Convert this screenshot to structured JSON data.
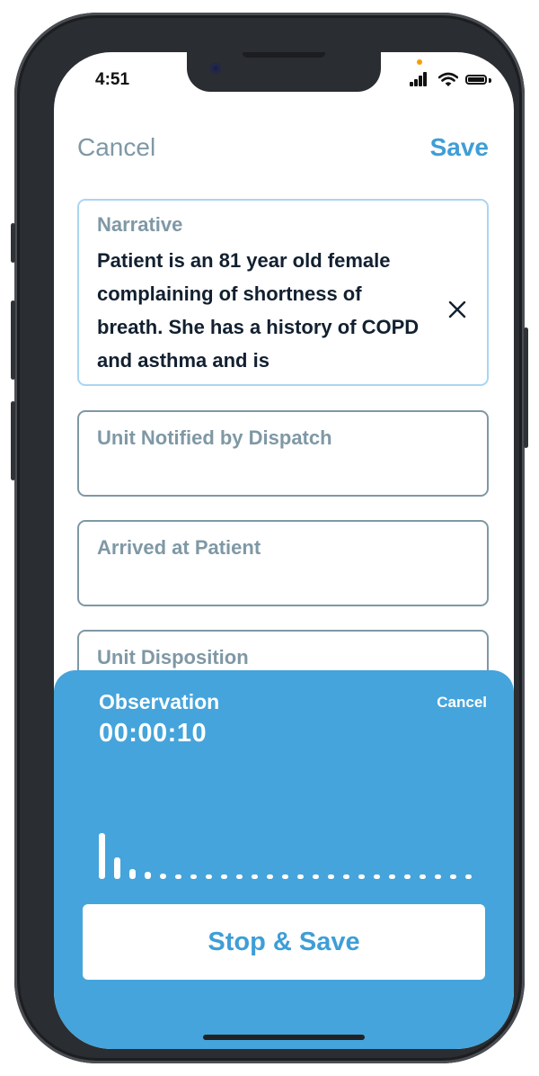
{
  "status_bar": {
    "time": "4:51"
  },
  "nav": {
    "cancel_label": "Cancel",
    "save_label": "Save"
  },
  "fields": {
    "narrative": {
      "label": "Narrative",
      "value": "Patient is an 81 year old female complaining of shortness of breath. She has a history of COPD and asthma and is"
    },
    "unit_notified": {
      "label": "Unit Notified by Dispatch"
    },
    "arrived_at_patient": {
      "label": "Arrived at Patient"
    },
    "unit_disposition": {
      "label": "Unit Disposition"
    }
  },
  "recording": {
    "title": "Observation",
    "timer": "00:00:10",
    "cancel_label": "Cancel",
    "stop_save_label": "Stop & Save",
    "waveform_levels": [
      0.8,
      0.38,
      0.17,
      0.12,
      0.1,
      0.08,
      0.08,
      0.08,
      0.08,
      0.08,
      0.08,
      0.08,
      0.08,
      0.08,
      0.08,
      0.08,
      0.08,
      0.08,
      0.08,
      0.08,
      0.08,
      0.08,
      0.08,
      0.08,
      0.08
    ]
  },
  "colors": {
    "accent": "#3e9ed7",
    "sheet_background": "#45a4db",
    "muted_label": "#7f98a5",
    "active_border": "#a9d6f0"
  }
}
